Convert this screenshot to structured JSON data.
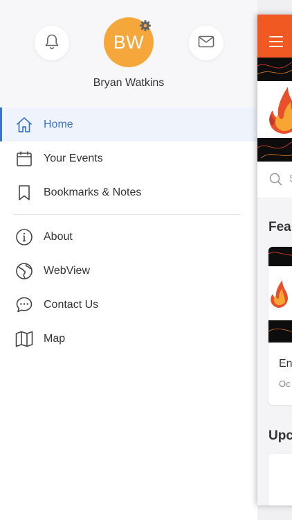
{
  "colors": {
    "accent": "#3b74c8",
    "avatar": "#f5a73b",
    "topbar": "#f05a22"
  },
  "drawer": {
    "header": {
      "notifications_icon": "bell-icon",
      "messages_icon": "envelope-icon",
      "avatar_initials": "BW",
      "settings_icon": "gear-icon",
      "user_name": "Bryan Watkins"
    },
    "menu_primary": [
      {
        "label": "Home",
        "icon": "home-icon",
        "active": true
      },
      {
        "label": "Your Events",
        "icon": "calendar-icon",
        "active": false
      },
      {
        "label": "Bookmarks & Notes",
        "icon": "bookmark-icon",
        "active": false
      }
    ],
    "menu_secondary": [
      {
        "label": "About",
        "icon": "info-icon"
      },
      {
        "label": "WebView",
        "icon": "globe-icon"
      },
      {
        "label": "Contact Us",
        "icon": "chat-icon"
      },
      {
        "label": "Map",
        "icon": "map-icon"
      }
    ]
  },
  "main": {
    "menu_icon": "hamburger-icon",
    "search_icon": "search-icon",
    "search_partial": "S",
    "featured_title": "Fea",
    "card_title": "En",
    "card_date": "Oc",
    "upcoming_title": "Upc"
  }
}
